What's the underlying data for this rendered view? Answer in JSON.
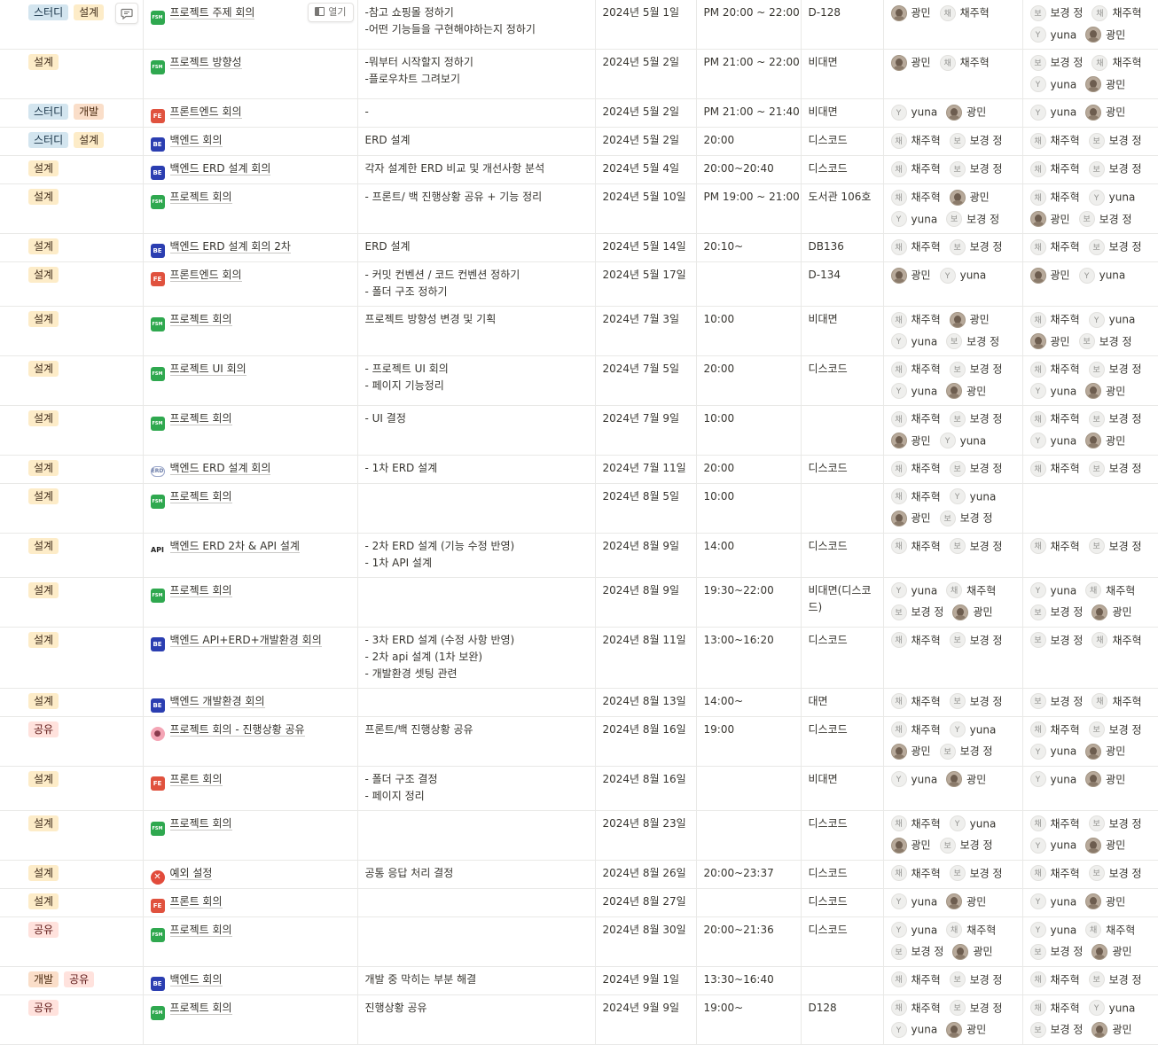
{
  "tag_labels": {
    "study": "스터디",
    "design": "설계",
    "dev": "개발",
    "share": "공유"
  },
  "ui": {
    "open_label": "열기"
  },
  "people": {
    "gwangmin": {
      "name": "광민",
      "avatar": "photo",
      "initial": ""
    },
    "jae": {
      "name": "채주혁",
      "avatar": "initial",
      "initial": "채"
    },
    "bo": {
      "name": "보경 정",
      "avatar": "initial",
      "initial": "보"
    },
    "yuna": {
      "name": "yuna",
      "avatar": "initial",
      "initial": "Y"
    }
  },
  "rows": [
    {
      "tags": [
        "study",
        "design"
      ],
      "icon": "fsm",
      "title": "프로젝트 주제 회의",
      "agenda": [
        "-참고 쇼핑몰 정하기",
        "-어떤 기능들을 구현해야하는지 정하기"
      ],
      "date": "2024년 5월 1일",
      "time": "PM 20:00 ~ 22:00",
      "place": "D-128",
      "attendees": [
        "gwangmin",
        "jae"
      ],
      "writers": [
        "bo",
        "jae",
        "yuna",
        "gwangmin"
      ]
    },
    {
      "tags": [
        "design"
      ],
      "icon": "fsm",
      "title": "프로젝트 방향성",
      "agenda": [
        "-뭐부터 시작할지 정하기",
        "-플로우차트 그려보기"
      ],
      "date": "2024년 5월 2일",
      "time": "PM 21:00 ~ 22:00",
      "place": "비대면",
      "attendees": [
        "gwangmin",
        "jae"
      ],
      "writers": [
        "bo",
        "jae",
        "yuna",
        "gwangmin"
      ]
    },
    {
      "tags": [
        "study",
        "dev"
      ],
      "icon": "fe",
      "title": "프론트엔드 회의",
      "agenda": [
        "-"
      ],
      "date": "2024년 5월 2일",
      "time": "PM 21:00 ~ 21:40",
      "place": "비대면",
      "attendees": [
        "yuna",
        "gwangmin"
      ],
      "writers": [
        "yuna",
        "gwangmin"
      ]
    },
    {
      "tags": [
        "study",
        "design"
      ],
      "icon": "be",
      "title": "백엔드 회의",
      "agenda": [
        "ERD 설계"
      ],
      "date": "2024년 5월 2일",
      "time": "20:00",
      "place": "디스코드",
      "attendees": [
        "jae",
        "bo"
      ],
      "writers": [
        "jae",
        "bo"
      ]
    },
    {
      "tags": [
        "design"
      ],
      "icon": "be",
      "title": "백엔드 ERD 설계 회의",
      "agenda": [
        "각자 설계한 ERD 비교 및 개선사항 분석"
      ],
      "date": "2024년 5월 4일",
      "time": "20:00~20:40",
      "place": "디스코드",
      "attendees": [
        "jae",
        "bo"
      ],
      "writers": [
        "jae",
        "bo"
      ]
    },
    {
      "tags": [
        "design"
      ],
      "icon": "fsm",
      "title": "프로젝트 회의",
      "agenda": [
        "- 프론트/ 백 진행상황 공유  +  기능 정리"
      ],
      "date": "2024년 5월 10일",
      "time": "PM 19:00 ~ 21:00",
      "place": "도서관 106호",
      "attendees": [
        "jae",
        "gwangmin",
        "yuna",
        "bo"
      ],
      "writers": [
        "jae",
        "yuna",
        "gwangmin",
        "bo"
      ]
    },
    {
      "tags": [
        "design"
      ],
      "icon": "be",
      "title": "백엔드 ERD 설계 회의 2차",
      "agenda": [
        "ERD 설계"
      ],
      "date": "2024년 5월 14일",
      "time": "20:10~",
      "place": "DB136",
      "attendees": [
        "jae",
        "bo"
      ],
      "writers": [
        "jae",
        "bo"
      ]
    },
    {
      "tags": [
        "design"
      ],
      "icon": "fe",
      "title": "프론트엔드 회의",
      "agenda": [
        "- 커밋 컨벤션 / 코드 컨벤션 정하기",
        "- 폴더 구조 정하기"
      ],
      "date": "2024년 5월 17일",
      "time": "",
      "place": "D-134",
      "attendees": [
        "gwangmin",
        "yuna"
      ],
      "writers": [
        "gwangmin",
        "yuna"
      ]
    },
    {
      "tags": [
        "design"
      ],
      "icon": "fsm",
      "title": "프로젝트 회의",
      "agenda": [
        "프로젝트 방향성 변경 및 기획"
      ],
      "date": "2024년 7월 3일",
      "time": "10:00",
      "place": "비대면",
      "attendees": [
        "jae",
        "gwangmin",
        "yuna",
        "bo"
      ],
      "writers": [
        "jae",
        "yuna",
        "gwangmin",
        "bo"
      ]
    },
    {
      "tags": [
        "design"
      ],
      "icon": "fsm",
      "title": "프로젝트 UI 회의",
      "agenda": [
        "- 프로젝트 UI 회의",
        "- 페이지 기능정리"
      ],
      "date": "2024년 7월 5일",
      "time": "20:00",
      "place": "디스코드",
      "attendees": [
        "jae",
        "bo",
        "yuna",
        "gwangmin"
      ],
      "writers": [
        "jae",
        "bo",
        "yuna",
        "gwangmin"
      ]
    },
    {
      "tags": [
        "design"
      ],
      "icon": "fsm",
      "title": "프로젝트 회의",
      "agenda": [
        "- UI 결정"
      ],
      "date": "2024년 7월 9일",
      "time": "10:00",
      "place": "",
      "attendees": [
        "jae",
        "bo",
        "gwangmin",
        "yuna"
      ],
      "writers": [
        "jae",
        "bo",
        "yuna",
        "gwangmin"
      ]
    },
    {
      "tags": [
        "design"
      ],
      "icon": "erd",
      "title": "백엔드 ERD 설계 회의",
      "agenda": [
        "- 1차 ERD 설계"
      ],
      "date": "2024년 7월 11일",
      "time": "20:00",
      "place": "디스코드",
      "attendees": [
        "jae",
        "bo"
      ],
      "writers": [
        "jae",
        "bo"
      ]
    },
    {
      "tags": [
        "design"
      ],
      "icon": "fsm",
      "title": "프로젝트 회의",
      "agenda": [],
      "date": "2024년 8월 5일",
      "time": "10:00",
      "place": "",
      "attendees": [
        "jae",
        "yuna",
        "gwangmin",
        "bo"
      ],
      "writers": []
    },
    {
      "tags": [
        "design"
      ],
      "icon": "api",
      "title": "백엔드 ERD 2차 & API 설계",
      "agenda": [
        "- 2차 ERD 설계 (기능 수정 반영)",
        "- 1차 API 설계"
      ],
      "date": "2024년 8월 9일",
      "time": "14:00",
      "place": "디스코드",
      "attendees": [
        "jae",
        "bo"
      ],
      "writers": [
        "jae",
        "bo"
      ]
    },
    {
      "tags": [
        "design"
      ],
      "icon": "fsm",
      "title": "프로젝트 회의",
      "agenda": [],
      "date": "2024년 8월 9일",
      "time": "19:30~22:00",
      "place": "비대면(디스코드)",
      "attendees": [
        "yuna",
        "jae",
        "bo",
        "gwangmin"
      ],
      "writers": [
        "yuna",
        "jae",
        "bo",
        "gwangmin"
      ]
    },
    {
      "tags": [
        "design"
      ],
      "icon": "be",
      "title": "백엔드 API+ERD+개발환경 회의",
      "agenda": [
        "- 3차 ERD 설계 (수정 사항 반영)",
        "- 2차 api 설계 (1차 보완)",
        "- 개발환경 셋팅 관련"
      ],
      "date": "2024년 8월 11일",
      "time": "13:00~16:20",
      "place": "디스코드",
      "attendees": [
        "jae",
        "bo"
      ],
      "writers": [
        "bo",
        "jae"
      ]
    },
    {
      "tags": [
        "design"
      ],
      "icon": "be",
      "title": "백엔드 개발환경 회의",
      "agenda": [],
      "date": "2024년 8월 13일",
      "time": "14:00~",
      "place": "대면",
      "attendees": [
        "jae",
        "bo"
      ],
      "writers": [
        "bo",
        "jae"
      ]
    },
    {
      "tags": [
        "share"
      ],
      "icon": "pig",
      "title": "프로젝트 회의 - 진행상황 공유",
      "agenda": [
        "프론트/백 진행상황 공유"
      ],
      "date": "2024년 8월 16일",
      "time": "19:00",
      "place": "디스코드",
      "attendees": [
        "jae",
        "yuna",
        "gwangmin",
        "bo"
      ],
      "writers": [
        "jae",
        "bo",
        "yuna",
        "gwangmin"
      ]
    },
    {
      "tags": [
        "design"
      ],
      "icon": "fe",
      "title": "프론트 회의",
      "agenda": [
        "- 폴더 구조 결정",
        "- 페이지 정리"
      ],
      "date": "2024년 8월 16일",
      "time": "",
      "place": "비대면",
      "attendees": [
        "yuna",
        "gwangmin"
      ],
      "writers": [
        "yuna",
        "gwangmin"
      ]
    },
    {
      "tags": [
        "design"
      ],
      "icon": "fsm",
      "title": "프로젝트 회의",
      "agenda": [],
      "date": "2024년 8월 23일",
      "time": "",
      "place": "디스코드",
      "attendees": [
        "jae",
        "yuna",
        "gwangmin",
        "bo"
      ],
      "writers": [
        "jae",
        "bo",
        "yuna",
        "gwangmin"
      ]
    },
    {
      "tags": [
        "design"
      ],
      "icon": "x",
      "title": "예외 설정",
      "agenda": [
        "공통 응답 처리 결정"
      ],
      "date": "2024년 8월 26일",
      "time": "20:00~23:37",
      "place": "디스코드",
      "attendees": [
        "jae",
        "bo"
      ],
      "writers": [
        "jae",
        "bo"
      ]
    },
    {
      "tags": [
        "design"
      ],
      "icon": "fe",
      "title": "프론트 회의",
      "agenda": [],
      "date": "2024년 8월 27일",
      "time": "",
      "place": "디스코드",
      "attendees": [
        "yuna",
        "gwangmin"
      ],
      "writers": [
        "yuna",
        "gwangmin"
      ]
    },
    {
      "tags": [
        "share"
      ],
      "icon": "fsm",
      "title": "프로젝트 회의",
      "agenda": [],
      "date": "2024년 8월 30일",
      "time": "20:00~21:36",
      "place": "디스코드",
      "attendees": [
        "yuna",
        "jae",
        "bo",
        "gwangmin"
      ],
      "writers": [
        "yuna",
        "jae",
        "bo",
        "gwangmin"
      ]
    },
    {
      "tags": [
        "dev",
        "share"
      ],
      "icon": "be",
      "title": "백엔드 회의",
      "agenda": [
        "개발 중 막히는 부분 해결"
      ],
      "date": "2024년 9월 1일",
      "time": "13:30~16:40",
      "place": "",
      "attendees": [
        "jae",
        "bo"
      ],
      "writers": [
        "jae",
        "bo"
      ]
    },
    {
      "tags": [
        "share"
      ],
      "icon": "fsm",
      "title": "프로젝트 회의",
      "agenda": [
        "진행상황 공유"
      ],
      "date": "2024년 9월 9일",
      "time": "19:00~",
      "place": "D128",
      "attendees": [
        "jae",
        "bo",
        "yuna",
        "gwangmin"
      ],
      "writers": [
        "jae",
        "yuna",
        "bo",
        "gwangmin"
      ]
    }
  ],
  "row_heights": [
    54,
    55,
    31,
    31,
    31,
    55,
    31,
    50,
    55,
    56,
    55,
    31,
    56,
    50,
    55,
    69,
    31,
    56,
    50,
    55,
    31,
    31,
    55,
    31,
    55
  ],
  "icon_glyphs": {
    "fsm": "FSM",
    "fe": "FE",
    "be": "BE",
    "api": "API",
    "erd": "ERD",
    "pig": "●",
    "x": "✕"
  }
}
